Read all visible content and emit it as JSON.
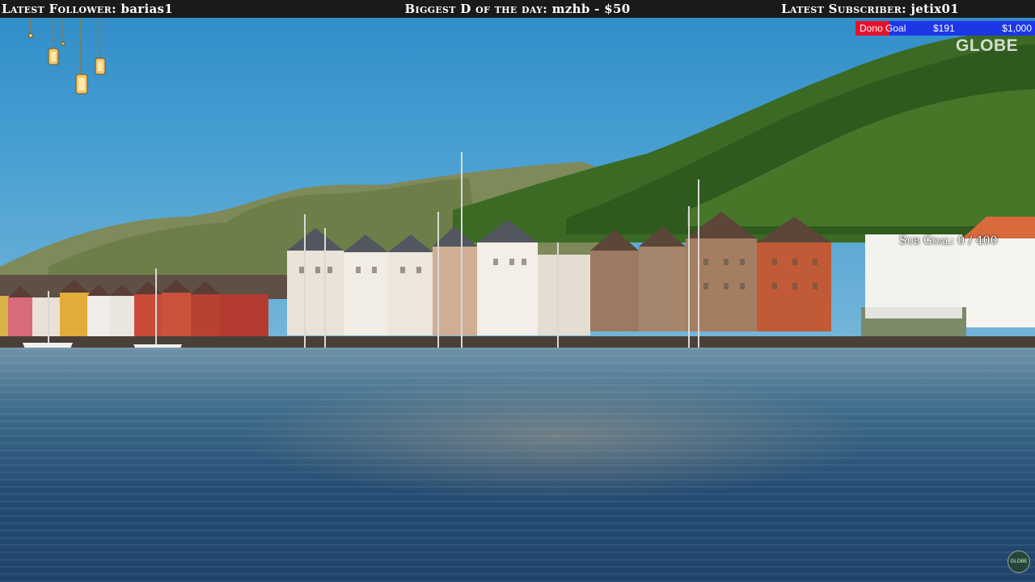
{
  "overlay": {
    "latest_follower_label": "Latest Follower:",
    "latest_follower_value": "barias1",
    "donation_label": "Biggest D of the day:",
    "donation_value": "mzhb - $50",
    "latest_subscriber_label": "Latest Subscriber:",
    "latest_subscriber_value": "jetix01"
  },
  "dono_goal": {
    "label": "Dono Goal",
    "current": "$191",
    "target": "$1,000",
    "progress": 0.191,
    "fill_color": "#e8112d",
    "bg_color": "#1d36e6"
  },
  "brand": {
    "name": "GLOBE",
    "watermark": "GLOBE"
  },
  "sub_goal": {
    "text": "Sub Goal: 0 / 400"
  },
  "icons": {
    "lanterns": "hanging-lanterns-icon"
  },
  "colors": {
    "topbar_bg": "#1a1a1a",
    "topbar_text": "#ffffff"
  }
}
